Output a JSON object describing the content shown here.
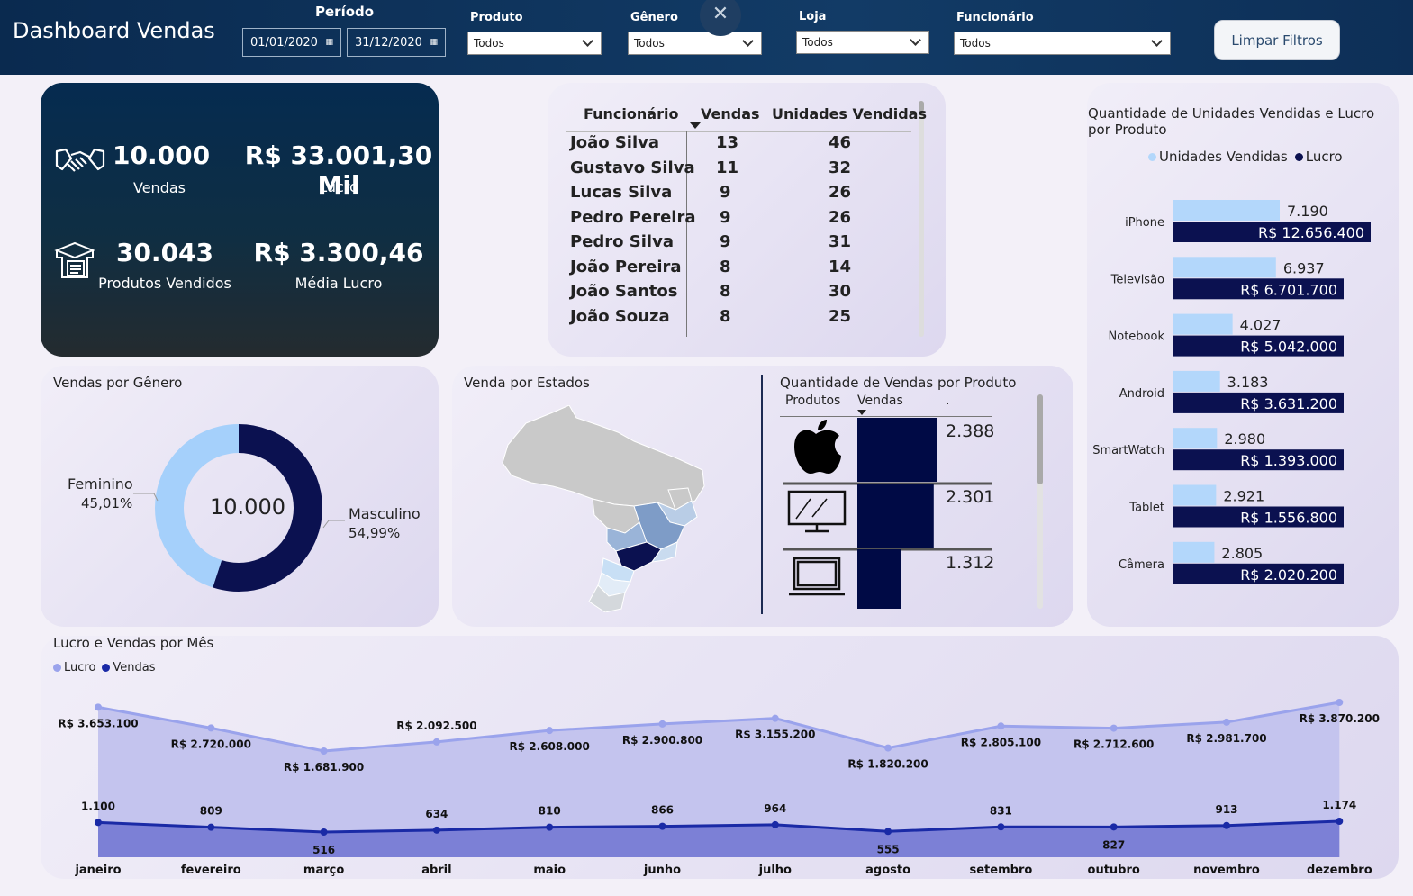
{
  "header": {
    "title": "Dashboard Vendas",
    "periodo_label": "Período",
    "date_start": "01/01/2020",
    "date_end": "31/12/2020",
    "filters": [
      {
        "label": "Produto",
        "value": "Todos"
      },
      {
        "label": "Gênero",
        "value": "Todos"
      },
      {
        "label": "Loja",
        "value": "Todos"
      },
      {
        "label": "Funcionário",
        "value": "Todos"
      }
    ],
    "clear_button": "Limpar Filtros",
    "close_symbol": "✕"
  },
  "kpis": {
    "vendas_value": "10.000",
    "vendas_label": "Vendas",
    "lucro_value": "R$ 33.001,30 Mil",
    "lucro_label": "Lucro",
    "produtos_value": "30.043",
    "produtos_label": "Produtos Vendidos",
    "media_value": "R$ 3.300,46",
    "media_label": "Média Lucro"
  },
  "employees": {
    "headers": [
      "Funcionário",
      "Vendas",
      "Unidades Vendidas"
    ],
    "rows": [
      {
        "name": "João Silva",
        "vendas": "13",
        "unidades": "46"
      },
      {
        "name": "Gustavo Silva",
        "vendas": "11",
        "unidades": "32"
      },
      {
        "name": "Lucas Silva",
        "vendas": "9",
        "unidades": "26"
      },
      {
        "name": "Pedro Pereira",
        "vendas": "9",
        "unidades": "26"
      },
      {
        "name": "Pedro Silva",
        "vendas": "9",
        "unidades": "31"
      },
      {
        "name": "João Pereira",
        "vendas": "8",
        "unidades": "14"
      },
      {
        "name": "João Santos",
        "vendas": "8",
        "unidades": "30"
      },
      {
        "name": "João Souza",
        "vendas": "8",
        "unidades": "25"
      }
    ]
  },
  "genero": {
    "title": "Vendas por Gênero",
    "center": "10.000",
    "fem_label": "Feminino",
    "fem_pct": "45,01%",
    "masc_label": "Masculino",
    "masc_pct": "54,99%",
    "fem_share": 0.4501,
    "fem_color": "#a5d0fb",
    "masc_color": "#0b1150"
  },
  "estados": {
    "title": "Venda por Estados"
  },
  "qtd_produto": {
    "title": "Quantidade de Vendas por Produto",
    "col_produtos": "Produtos",
    "col_vendas": "Vendas",
    "col_dot": ".",
    "rows": [
      {
        "icon": "apple-icon",
        "value": "2.388",
        "num": 2388
      },
      {
        "icon": "monitor-icon",
        "value": "2.301",
        "num": 2301
      },
      {
        "icon": "laptop-icon",
        "value": "1.312",
        "num": 1312
      }
    ]
  },
  "unidades_lucro": {
    "title": "Quantidade de Unidades Vendidas e Lucro por Produto",
    "legend_units": "Unidades Vendidas",
    "legend_lucro": "Lucro",
    "units_color": "#b3d7fb",
    "lucro_color": "#0b1150",
    "rows": [
      {
        "product": "iPhone",
        "units": "7.190",
        "lucro": "R$ 12.656.400"
      },
      {
        "product": "Televisão",
        "units": "6.937",
        "lucro": "R$ 6.701.700"
      },
      {
        "product": "Notebook",
        "units": "4.027",
        "lucro": "R$ 5.042.000"
      },
      {
        "product": "Android",
        "units": "3.183",
        "lucro": "R$ 3.631.200"
      },
      {
        "product": "SmartWatch",
        "units": "2.980",
        "lucro": "R$ 1.393.000"
      },
      {
        "product": "Tablet",
        "units": "2.921",
        "lucro": "R$ 1.556.800"
      },
      {
        "product": "Câmera",
        "units": "2.805",
        "lucro": "R$ 2.020.200"
      }
    ]
  },
  "mensal": {
    "title": "Lucro e Vendas por Mês",
    "legend_lucro": "Lucro",
    "legend_vendas": "Vendas",
    "lucro_color": "#9aa3ec",
    "vendas_color": "#1a2aa6"
  },
  "chart_data": [
    {
      "type": "bar",
      "title": "Quantidade de Unidades Vendidas e Lucro por Produto",
      "categories": [
        "iPhone",
        "Televisão",
        "Notebook",
        "Android",
        "SmartWatch",
        "Tablet",
        "Câmera"
      ],
      "series": [
        {
          "name": "Unidades Vendidas",
          "values": [
            7190,
            6937,
            4027,
            3183,
            2980,
            2921,
            2805
          ]
        },
        {
          "name": "Lucro",
          "values": [
            12656400,
            6701700,
            5042000,
            3631200,
            1393000,
            1556800,
            2020200
          ]
        }
      ]
    },
    {
      "type": "line",
      "title": "Lucro e Vendas por Mês",
      "categories": [
        "janeiro",
        "fevereiro",
        "março",
        "abril",
        "maio",
        "junho",
        "julho",
        "agosto",
        "setembro",
        "outubro",
        "novembro",
        "dezembro"
      ],
      "series": [
        {
          "name": "Lucro",
          "values": [
            3653100,
            2720000,
            1681900,
            2092500,
            2608000,
            2900800,
            3155200,
            1820200,
            2805100,
            2712600,
            2981700,
            3870200
          ],
          "labels": [
            "R$ 3.653.100",
            "R$ 2.720.000",
            "R$ 1.681.900",
            "R$ 2.092.500",
            "R$ 2.608.000",
            "R$ 2.900.800",
            "R$ 3.155.200",
            "R$ 1.820.200",
            "R$ 2.805.100",
            "R$ 2.712.600",
            "R$ 2.981.700",
            "R$ 3.870.200"
          ]
        },
        {
          "name": "Vendas",
          "values": [
            1100,
            809,
            516,
            634,
            810,
            866,
            964,
            555,
            831,
            827,
            913,
            1174
          ],
          "labels": [
            "1.100",
            "809",
            "516",
            "634",
            "810",
            "866",
            "964",
            "555",
            "831",
            "827",
            "913",
            "1.174"
          ]
        }
      ]
    },
    {
      "type": "pie",
      "title": "Vendas por Gênero",
      "categories": [
        "Feminino",
        "Masculino"
      ],
      "values": [
        45.01,
        54.99
      ]
    }
  ]
}
